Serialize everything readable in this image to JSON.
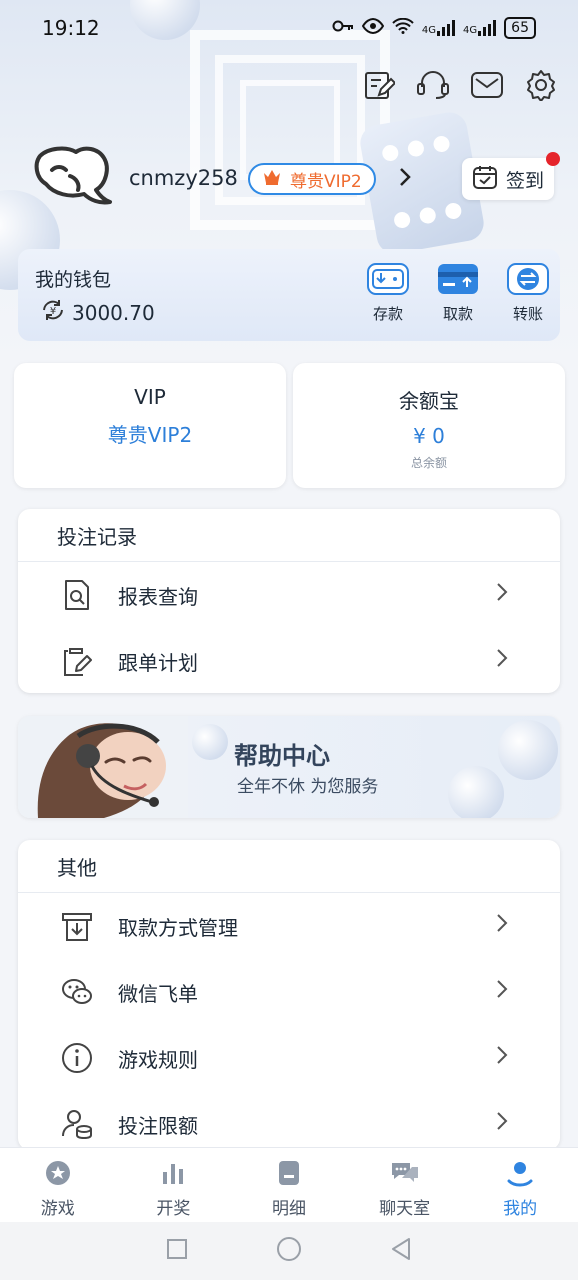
{
  "status_bar": {
    "time": "19:12",
    "network1": "4G",
    "network2": "4G",
    "battery": "65"
  },
  "user": {
    "username": "cnmzy258",
    "vip_badge": "尊贵VIP2",
    "signin_label": "签到"
  },
  "wallet": {
    "title": "我的钱包",
    "balance": "3000.70",
    "actions": [
      {
        "label": "存款"
      },
      {
        "label": "取款"
      },
      {
        "label": "转账"
      }
    ]
  },
  "vip_card": {
    "title": "VIP",
    "value": "尊贵VIP2"
  },
  "yuebao_card": {
    "title": "余额宝",
    "value": "¥ 0",
    "sub": "总余额"
  },
  "bet_records": {
    "title": "投注记录",
    "items": [
      {
        "label": "报表查询"
      },
      {
        "label": "跟单计划"
      }
    ]
  },
  "help_banner": {
    "title": "帮助中心",
    "subtitle": "全年不休 为您服务"
  },
  "others": {
    "title": "其他",
    "items": [
      {
        "label": "取款方式管理"
      },
      {
        "label": "微信飞单"
      },
      {
        "label": "游戏规则"
      },
      {
        "label": "投注限额"
      }
    ]
  },
  "tabs": [
    {
      "label": "游戏"
    },
    {
      "label": "开奖"
    },
    {
      "label": "明细"
    },
    {
      "label": "聊天室"
    },
    {
      "label": "我的"
    }
  ],
  "colors": {
    "accent": "#2f84e0",
    "vip_text": "#ef6b2f",
    "badge_red": "#e5242b"
  }
}
